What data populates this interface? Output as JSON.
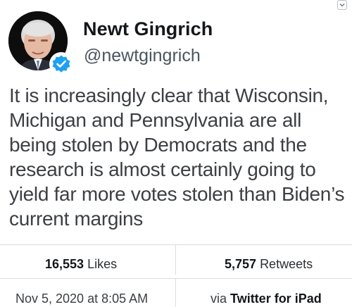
{
  "author": {
    "name": "Newt Gingrich",
    "handle": "@newtgingrich",
    "verified": true,
    "avatar_icon": "profile-photo"
  },
  "tweet": {
    "text": "It is increasingly clear that Wisconsin, Michigan and Pennsylvania are all being stolen by Democrats and the research is almost certainly going to yield far more votes stolen than Biden’s current margins"
  },
  "stats": {
    "likes_count": "16,553",
    "likes_label": "Likes",
    "retweets_count": "5,757",
    "retweets_label": "Retweets"
  },
  "meta": {
    "timestamp": "Nov 5, 2020 at 8:05 AM",
    "via_label": "via",
    "source": "Twitter for iPad"
  },
  "colors": {
    "verified_badge": "#1da1f2",
    "text_primary": "#14171a",
    "text_secondary": "#4a5560",
    "divider": "#d9dde1"
  }
}
